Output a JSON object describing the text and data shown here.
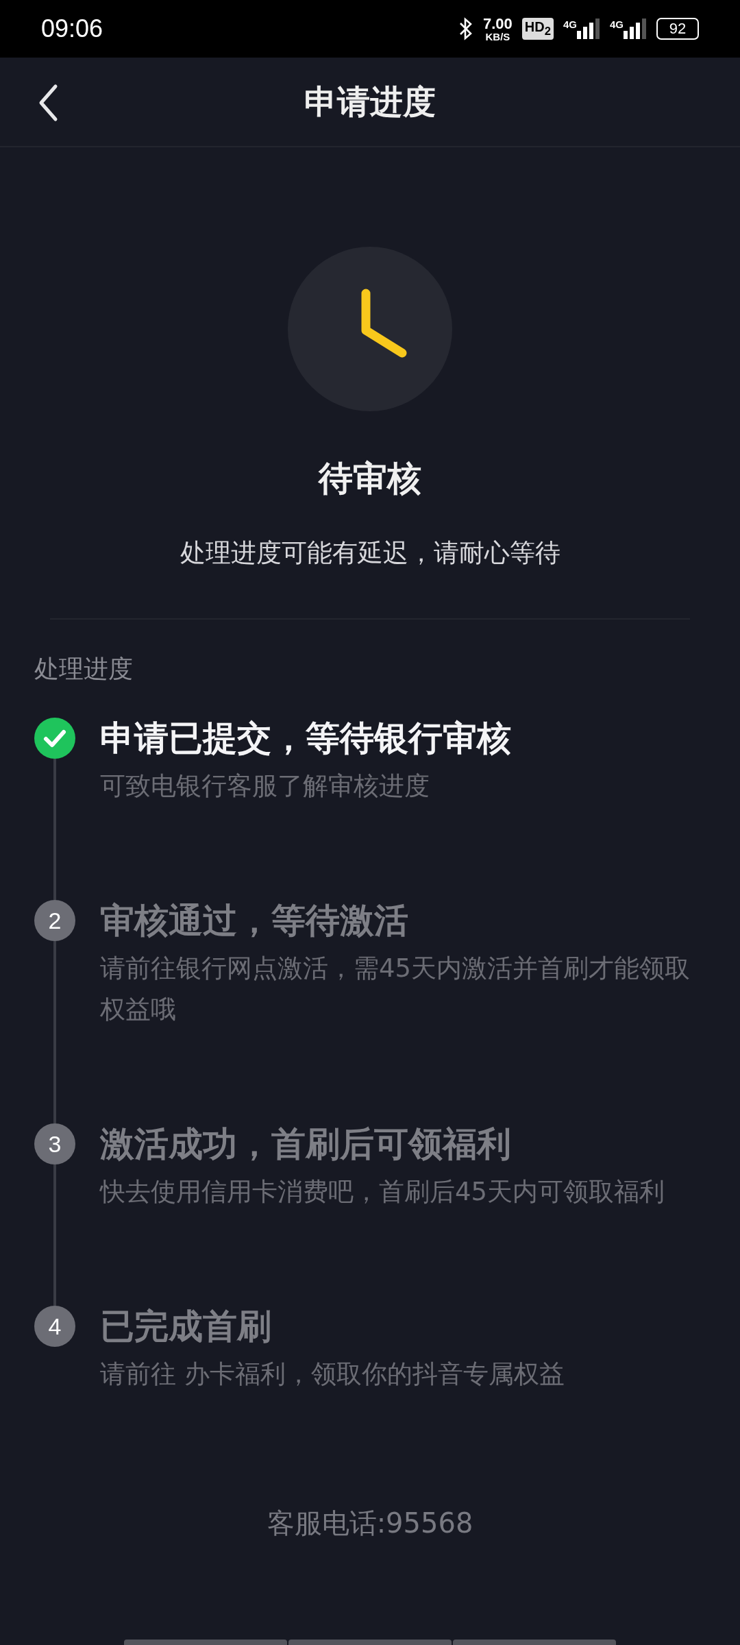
{
  "status_bar": {
    "time": "09:06",
    "speed_value": "7.00",
    "speed_unit": "KB/S",
    "hd": "HD$_{2}$",
    "networks": [
      "4G",
      "4G"
    ],
    "battery": "92"
  },
  "header": {
    "title": "申请进度"
  },
  "status": {
    "title": "待审核",
    "subtitle": "处理进度可能有延迟，请耐心等待"
  },
  "section_title": "处理进度",
  "steps": [
    {
      "done": true,
      "title": "申请已提交，等待银行审核",
      "description": "可致电银行客服了解审核进度"
    },
    {
      "done": false,
      "number": "2",
      "title": "审核通过，等待激活",
      "description": "请前往银行网点激活，需45天内激活并首刷才能领取权益哦"
    },
    {
      "done": false,
      "number": "3",
      "title": "激活成功，首刷后可领福利",
      "description": "快去使用信用卡消费吧，首刷后45天内可领取福利"
    },
    {
      "done": false,
      "number": "4",
      "title": "已完成首刷",
      "description": "请前往 办卡福利，领取你的抖音专属权益"
    }
  ],
  "footer": {
    "hotline": "客服电话:95568"
  }
}
